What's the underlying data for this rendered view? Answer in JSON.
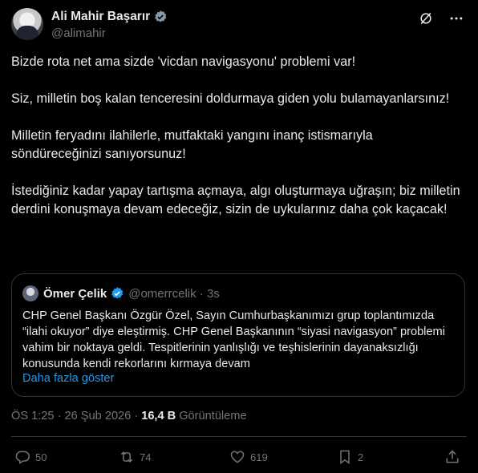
{
  "author": {
    "name": "Ali Mahir Başarır",
    "handle": "@alimahir"
  },
  "tweet": {
    "paragraphs": [
      "Bizde rota net ama sizde 'vicdan navigasyonu' problemi var!",
      "Siz, milletin boş kalan tenceresini doldurmaya giden yolu bulamayanlarsınız!",
      "Milletin feryadını ilahilerle, mutfaktaki yangını inanç istismarıyla söndüreceğinizi sanıyorsunuz!",
      "İstediğiniz kadar yapay tartışma açmaya, algı oluşturmaya uğraşın; biz milletin derdini konuşmaya devam edeceğiz, sizin de uykularınız daha çok kaçacak!"
    ]
  },
  "quote": {
    "name": "Ömer Çelik",
    "handle_time": "@omerrcelik · 3s",
    "text": "CHP Genel Başkanı Özgür Özel, Sayın Cumhurbaşkanımızı grup toplantımızda “ilahi okuyor” diye eleştirmiş. CHP Genel Başkanının “siyasi navigasyon” problemi vahim bir noktaya geldi. Tespitlerinin yanlışlığı ve teşhislerinin dayanaksızlığı konusunda kendi rekorlarını kırmaya devam",
    "show_more": "Daha fazla göster"
  },
  "meta": {
    "time": "ÖS 1:25 · 26 Şub 2026 ·",
    "views_count": "16,4 B",
    "views_label": "Görüntüleme"
  },
  "actions": {
    "replies": "50",
    "reposts": "74",
    "likes": "619",
    "bookmarks": "2"
  },
  "colors": {
    "background": "#000000",
    "text": "#e7e9ea",
    "muted": "#71767b",
    "accent": "#1d9bf0",
    "border": "#2f3336"
  },
  "icons": [
    "verified-badge-icon",
    "grok-icon",
    "more-icon",
    "reply-icon",
    "repost-icon",
    "like-icon",
    "bookmark-icon",
    "share-icon"
  ]
}
